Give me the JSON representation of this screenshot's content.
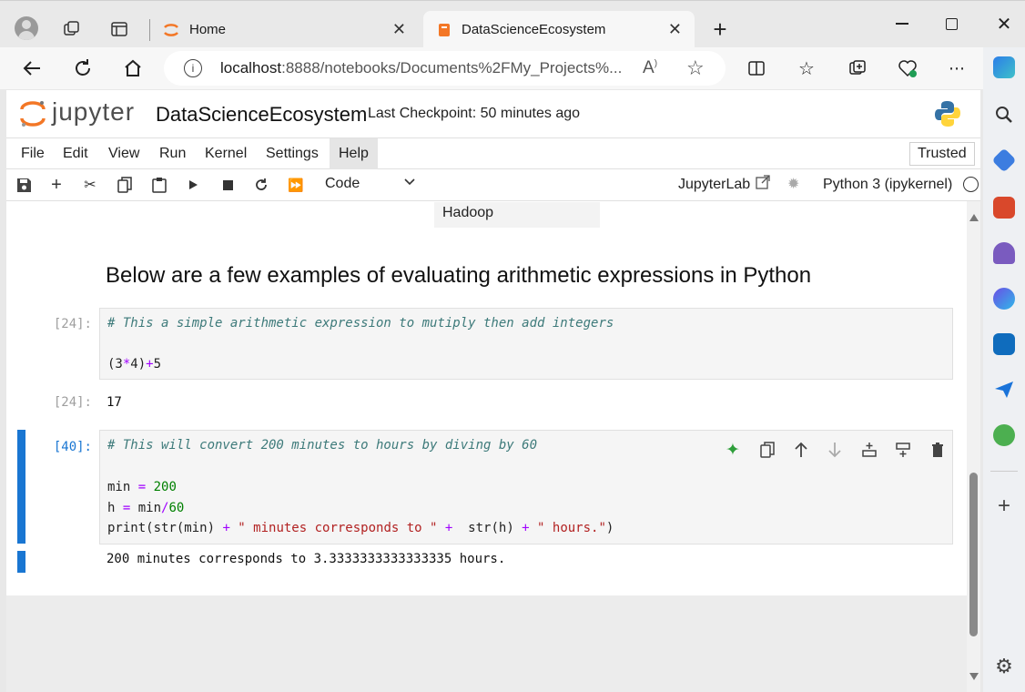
{
  "browser": {
    "tabs": [
      {
        "label": "Home"
      },
      {
        "label": "DataScienceEcosystem"
      }
    ],
    "url_host": "localhost",
    "url_path": ":8888/notebooks/Documents%2FMy_Projects%..."
  },
  "jupyter": {
    "logo_text": "jupyter",
    "notebook_title": "DataScienceEcosystem",
    "checkpoint": "Last Checkpoint: 50 minutes ago",
    "menu": [
      "File",
      "Edit",
      "View",
      "Run",
      "Kernel",
      "Settings",
      "Help"
    ],
    "trusted": "Trusted",
    "cell_type": "Code",
    "jupyterlab_link": "JupyterLab",
    "kernel": "Python 3 (ipykernel)"
  },
  "notebook": {
    "prev_output": "Hadoop",
    "heading": "Below are a few examples of evaluating arithmetic expressions in Python",
    "cell1": {
      "prompt": "[24]:",
      "comment": "# This a simple arithmetic expression to mutiply then add integers",
      "code_a": "(3",
      "code_b": "*",
      "code_c": "4)",
      "code_d": "+",
      "code_e": "5",
      "out_prompt": "[24]:",
      "output": "17"
    },
    "cell2": {
      "prompt": "[40]:",
      "comment": "# This will convert 200 minutes to hours by diving by 60",
      "line2a": "min ",
      "line2b": "=",
      "line2c": " 200",
      "line3a": "h ",
      "line3b": "=",
      "line3c": " min",
      "line3d": "/",
      "line3e": "60",
      "line4a": "print(str(min) ",
      "line4b": "+",
      "line4c": " \" minutes corresponds to \"",
      "line4d": " +",
      "line4e": "  str(h) ",
      "line4f": "+",
      "line4g": " \" hours.\"",
      "line4h": ")",
      "output": "200 minutes corresponds to 3.3333333333333335 hours."
    }
  }
}
